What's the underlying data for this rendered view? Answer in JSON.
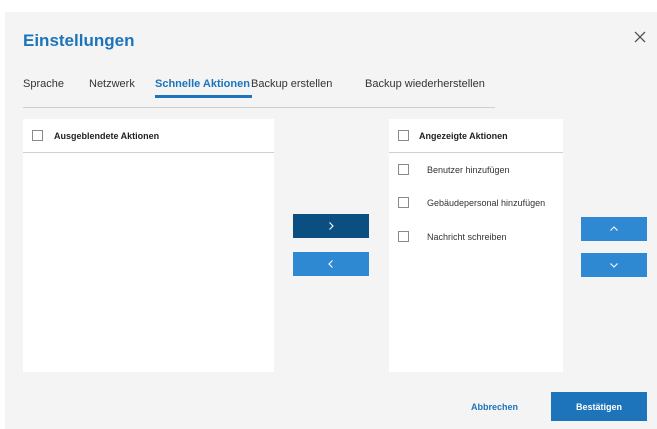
{
  "dialog": {
    "title": "Einstellungen",
    "close_icon": "close-icon"
  },
  "tabs": [
    {
      "label": "Sprache",
      "active": false
    },
    {
      "label": "Netzwerk",
      "active": false
    },
    {
      "label": "Schnelle Aktionen",
      "active": true
    },
    {
      "label": "Backup erstellen",
      "active": false
    },
    {
      "label": "Backup wiederherstellen",
      "active": false
    }
  ],
  "hidden_panel": {
    "header": "Ausgeblendete Aktionen",
    "items": []
  },
  "shown_panel": {
    "header": "Angezeigte Aktionen",
    "items": [
      {
        "label": "Benutzer hinzufügen"
      },
      {
        "label": "Gebäudepersonal hinzufügen"
      },
      {
        "label": "Nachricht schreiben"
      }
    ]
  },
  "transfer_buttons": {
    "move_right_icon": "chevron-right-icon",
    "move_left_icon": "chevron-left-icon"
  },
  "order_buttons": {
    "move_up_icon": "chevron-up-icon",
    "move_down_icon": "chevron-down-icon"
  },
  "footer": {
    "cancel_label": "Abbrechen",
    "confirm_label": "Bestätigen"
  },
  "colors": {
    "accent": "#1d74bb",
    "dark_button": "#0b4e82",
    "light_button": "#2f88d2",
    "dialog_bg": "#f4f4f4"
  }
}
